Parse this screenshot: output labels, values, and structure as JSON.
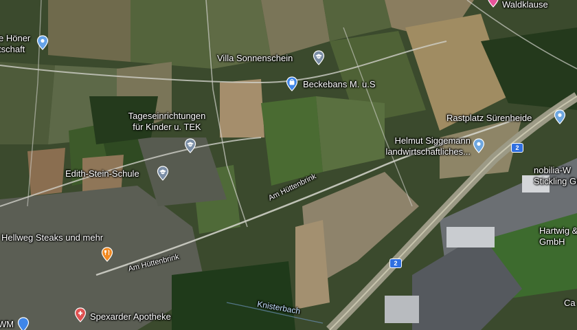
{
  "map": {
    "view": "satellite",
    "places": [
      {
        "id": "hoener",
        "text": "e Höner\ntschaft",
        "icon": "map-pin-icon",
        "color": "#66a3e8"
      },
      {
        "id": "waldklause",
        "text": "Waldklause",
        "icon": "restaurant-pin-icon",
        "color": "#e7549b"
      },
      {
        "id": "villa",
        "text": "Villa Sonnenschein",
        "icon": "school-pin-icon",
        "color": "#7b8ea6"
      },
      {
        "id": "beckebans",
        "text": "Beckebans M. u.S",
        "icon": "shopping-pin-icon",
        "color": "#3f86e8"
      },
      {
        "id": "tagesein",
        "text": "Tageseinrichtungen\nfür Kinder u. TEK",
        "icon": "school-pin-icon",
        "color": "#7b8ea6"
      },
      {
        "id": "rastplatz",
        "text": "Rastplatz Sürenheide",
        "icon": "map-pin-icon",
        "color": "#6ea7e0"
      },
      {
        "id": "siggemann",
        "text": "Helmut Siggemann\nlandwirtschaftliches...",
        "icon": "map-pin-icon",
        "color": "#6ea7e0"
      },
      {
        "id": "edith",
        "text": "Edith-Stein-Schule",
        "icon": "school-pin-icon",
        "color": "#7b8ea6"
      },
      {
        "id": "nobilia",
        "text": "nobilia-W\nStickling Gm",
        "icon": "",
        "color": ""
      },
      {
        "id": "hartwig",
        "text": "Hartwig & F\nGmbH",
        "icon": "",
        "color": ""
      },
      {
        "id": "hellweg",
        "text": "Hellweg Steaks und mehr",
        "icon": "restaurant-pin-icon",
        "color": "#f08a24"
      },
      {
        "id": "apotheke",
        "text": "Spexarder Apotheke",
        "icon": "pharmacy-pin-icon",
        "color": "#e05252"
      },
      {
        "id": "ca",
        "text": "Ca",
        "icon": "",
        "color": ""
      },
      {
        "id": "wm",
        "text": "WM",
        "icon": "shopping-pin-icon",
        "color": "#3f86e8"
      }
    ],
    "streets": [
      {
        "id": "huettenbrink1",
        "text": "Am Hüttenbrink"
      },
      {
        "id": "huettenbrink2",
        "text": "Am Hüttenbrink"
      }
    ],
    "water": [
      {
        "id": "knisterbach",
        "text": "Knisterbach"
      }
    ],
    "route_shields": [
      "2",
      "2"
    ]
  }
}
